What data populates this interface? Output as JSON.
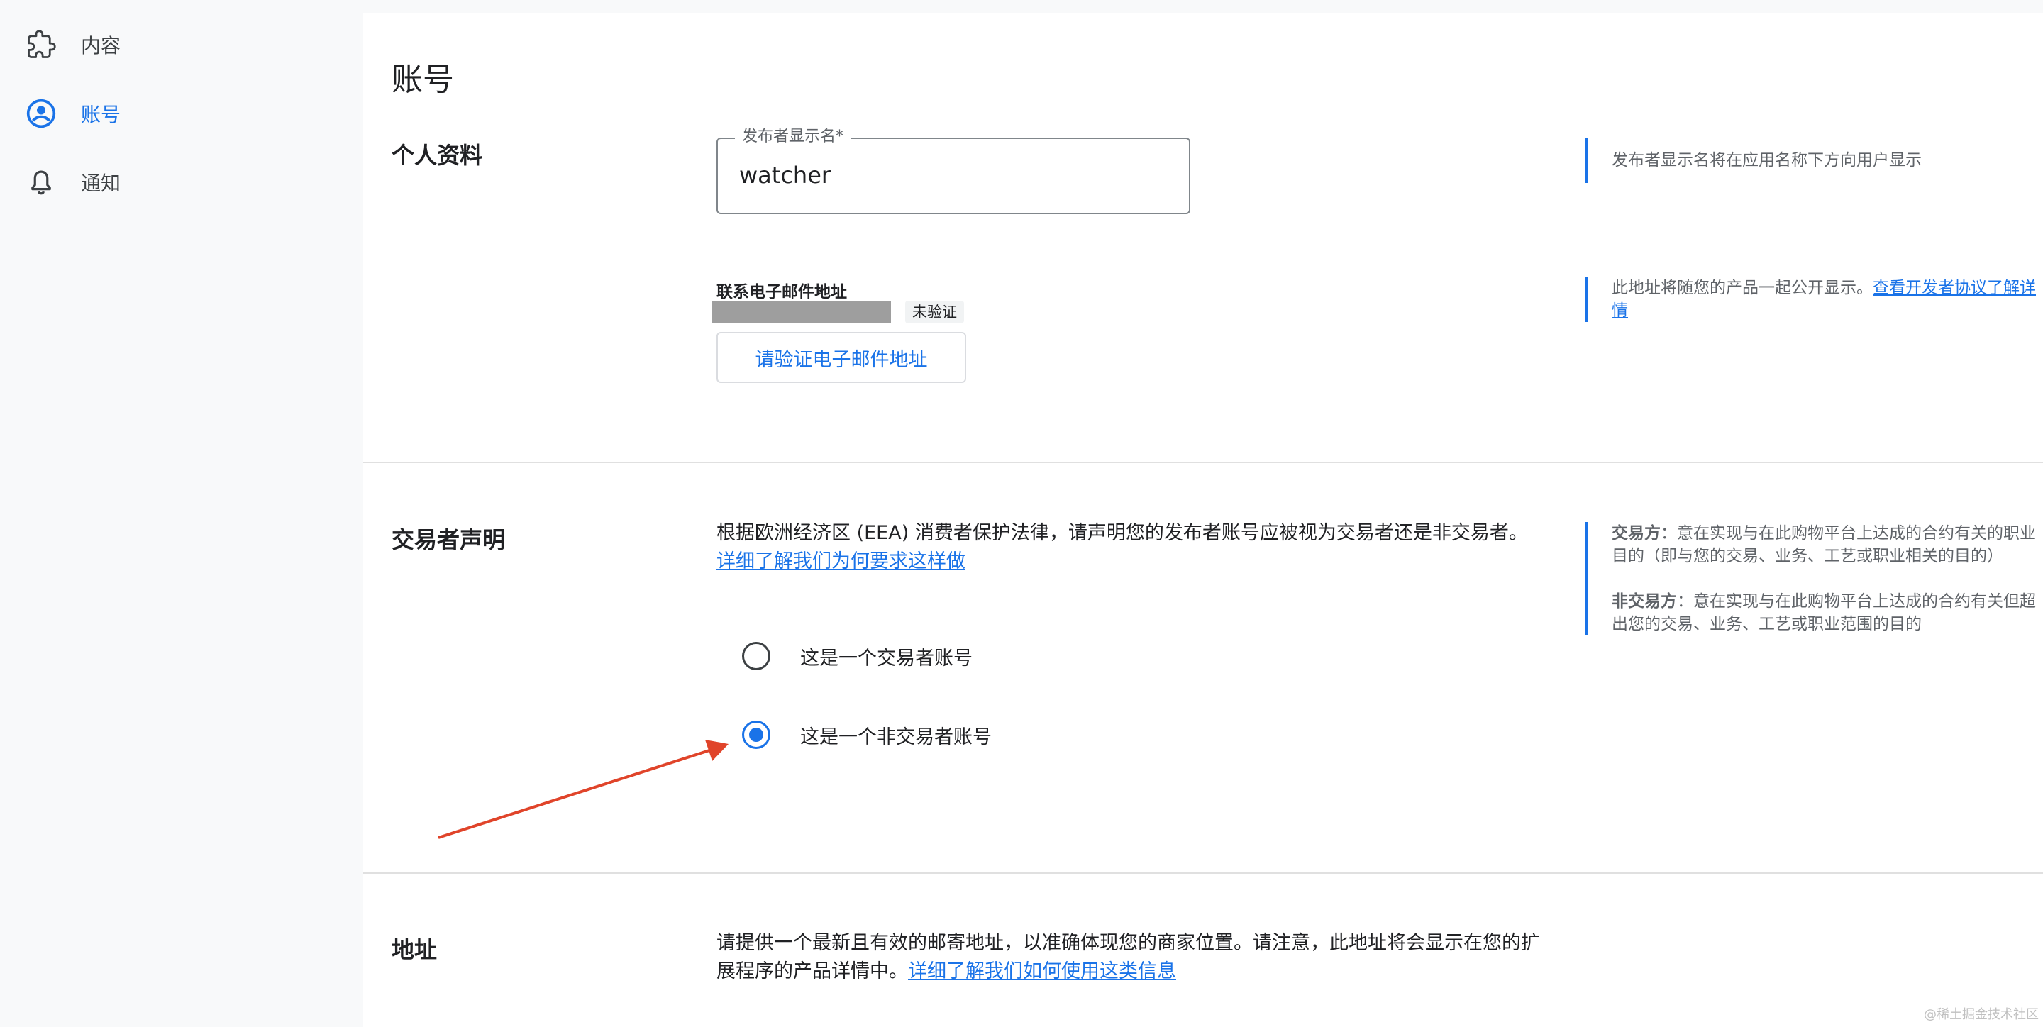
{
  "sidebar": {
    "items": [
      {
        "label": "内容",
        "icon": "puzzle-icon"
      },
      {
        "label": "账号",
        "icon": "account-circle-icon",
        "active": true
      },
      {
        "label": "通知",
        "icon": "bell-icon"
      }
    ]
  },
  "page": {
    "title": "账号"
  },
  "profile": {
    "section_label": "个人资料",
    "display_name_label": "发布者显示名*",
    "display_name_value": "watcher",
    "display_name_help": "发布者显示名将在应用名称下方向用户显示",
    "email_label": "联系电子邮件地址",
    "email_badge": "未验证",
    "verify_button": "请验证电子邮件地址",
    "email_help_text": "此地址将随您的产品一起公开显示。",
    "email_help_link": "查看开发者协议了解详情"
  },
  "trader": {
    "section_label": "交易者声明",
    "description": "根据欧洲经济区 (EEA) 消费者保护法律，请声明您的发布者账号应被视为交易者还是非交易者。",
    "description_link": "详细了解我们为何要求这样做",
    "options": [
      {
        "label": "这是一个交易者账号",
        "checked": false
      },
      {
        "label": "这是一个非交易者账号",
        "checked": true
      }
    ],
    "help_trader_term": "交易方",
    "help_trader_text": "：意在实现与在此购物平台上达成的合约有关的职业目的（即与您的交易、业务、工艺或职业相关的目的）",
    "help_nontrader_term": "非交易方",
    "help_nontrader_text": "：意在实现与在此购物平台上达成的合约有关但超出您的交易、业务、工艺或职业范围的目的"
  },
  "address": {
    "section_label": "地址",
    "description": "请提供一个最新且有效的邮寄地址，以准确体现您的商家位置。请注意，此地址将会显示在您的扩展程序的产品详情中。",
    "description_link": "详细了解我们如何使用这类信息"
  },
  "watermark": "@稀土掘金技术社区",
  "colors": {
    "accent": "#1a73e8",
    "annotation_arrow": "#e0442a",
    "redaction": "#9e9e9e"
  }
}
